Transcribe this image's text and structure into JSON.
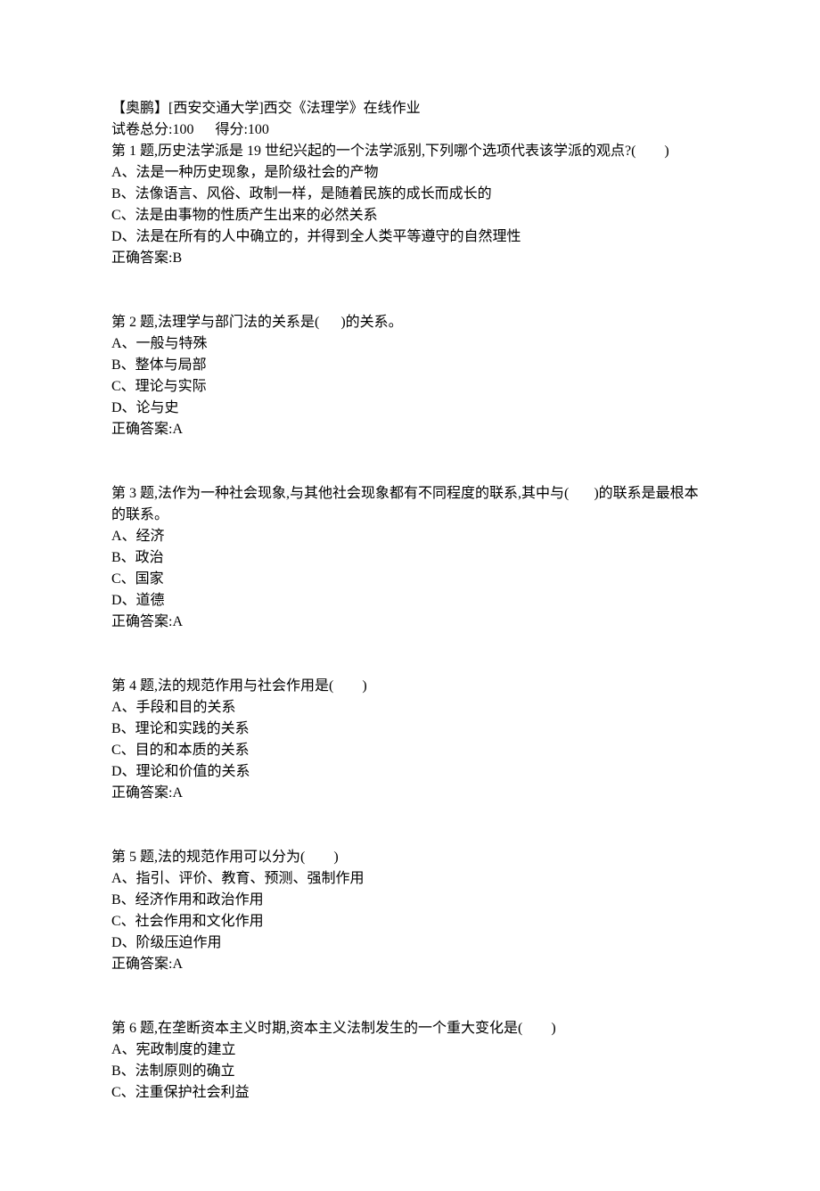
{
  "header": {
    "title": "【奥鹏】[西安交通大学]西交《法理学》在线作业",
    "scoreline": "试卷总分:100      得分:100"
  },
  "questions": [
    {
      "prompt": "第 1 题,历史法学派是 19 世纪兴起的一个法学派别,下列哪个选项代表该学派的观点?(        )",
      "options": [
        "A、法是一种历史现象，是阶级社会的产物",
        "B、法像语言、风俗、政制一样，是随着民族的成长而成长的",
        "C、法是由事物的性质产生出来的必然关系",
        "D、法是在所有的人中确立的，并得到全人类平等遵守的自然理性"
      ],
      "answer": "正确答案:B"
    },
    {
      "prompt": "第 2 题,法理学与部门法的关系是(      )的关系。",
      "options": [
        "A、一般与特殊",
        "B、整体与局部",
        "C、理论与实际",
        "D、论与史"
      ],
      "answer": "正确答案:A"
    },
    {
      "prompt": "第 3 题,法作为一种社会现象,与其他社会现象都有不同程度的联系,其中与(       )的联系是最根本的联系。",
      "options": [
        "A、经济",
        "B、政治",
        "C、国家",
        "D、道德"
      ],
      "answer": "正确答案:A"
    },
    {
      "prompt": "第 4 题,法的规范作用与社会作用是(        )",
      "options": [
        "A、手段和目的关系",
        "B、理论和实践的关系",
        "C、目的和本质的关系",
        "D、理论和价值的关系"
      ],
      "answer": "正确答案:A"
    },
    {
      "prompt": "第 5 题,法的规范作用可以分为(        )",
      "options": [
        "A、指引、评价、教育、预测、强制作用",
        "B、经济作用和政治作用",
        "C、社会作用和文化作用",
        "D、阶级压迫作用"
      ],
      "answer": "正确答案:A"
    },
    {
      "prompt": "第 6 题,在垄断资本主义时期,资本主义法制发生的一个重大变化是(        )",
      "options": [
        "A、宪政制度的建立",
        "B、法制原则的确立",
        "C、注重保护社会利益"
      ],
      "answer": ""
    }
  ]
}
